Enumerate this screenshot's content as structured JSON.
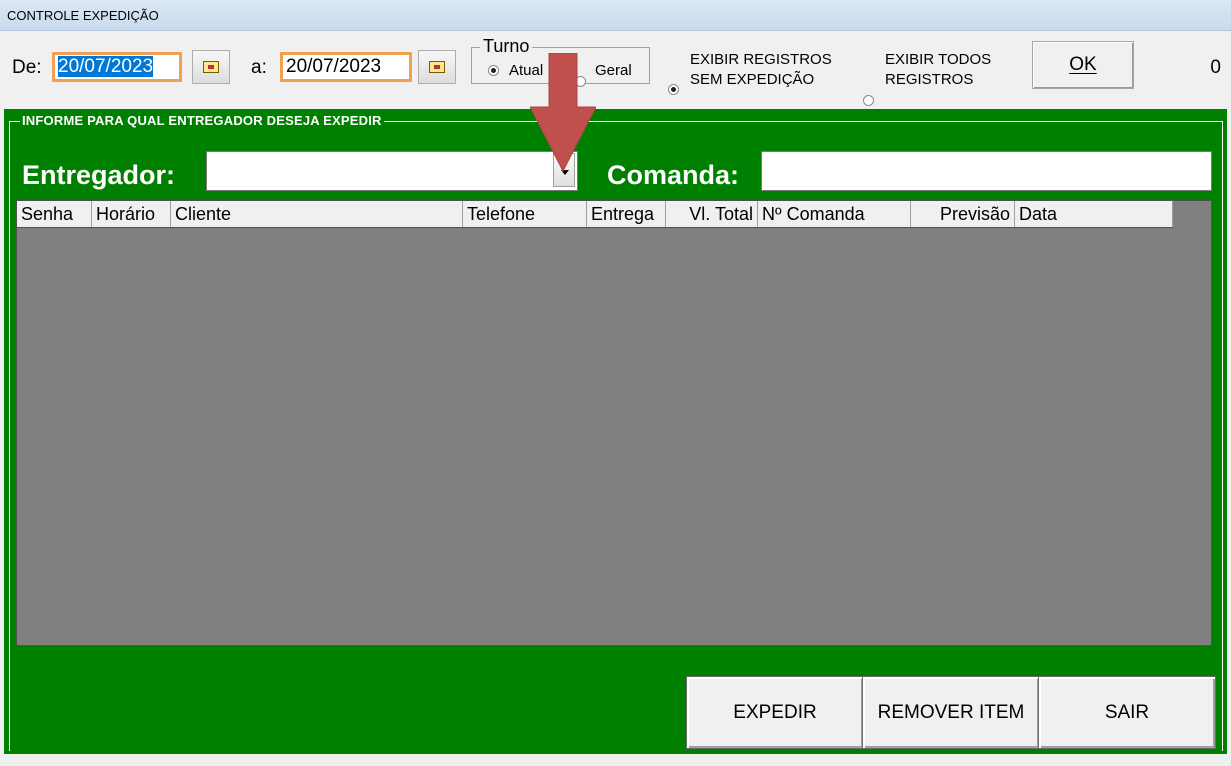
{
  "window": {
    "title": "CONTROLE EXPEDIÇÃO"
  },
  "filters": {
    "from_label": "De:",
    "from_date": "20/07/2023",
    "to_label": "a:",
    "to_date": "20/07/2023",
    "turno": {
      "legend": "Turno",
      "options": [
        {
          "label": "Atual",
          "selected": true
        },
        {
          "label": "Geral",
          "selected": false
        }
      ]
    },
    "display_options": [
      {
        "label_line1": "EXIBIR REGISTROS",
        "label_line2": "SEM EXPEDIÇÃO",
        "selected": true
      },
      {
        "label_line1": "EXIBIR TODOS",
        "label_line2": "REGISTROS",
        "selected": false
      }
    ],
    "ok_label": "OK",
    "record_count": "0"
  },
  "panel": {
    "legend": "INFORME PARA QUAL ENTREGADOR DESEJA EXPEDIR",
    "entregador_label": "Entregador:",
    "entregador_value": "",
    "comanda_label": "Comanda:",
    "comanda_value": ""
  },
  "grid": {
    "columns": [
      "Senha",
      "Horário",
      "Cliente",
      "Telefone",
      "Entrega",
      "Vl. Total",
      "Nº Comanda",
      "Previsão",
      "Data"
    ],
    "rows": []
  },
  "actions": {
    "expedir": "EXPEDIR",
    "remover": "REMOVER ITEM",
    "sair": "SAIR"
  },
  "colors": {
    "panel_green": "#008000",
    "grid_gray": "#808080",
    "highlight_orange": "#f0a050",
    "annotation_arrow": "#c0504d"
  }
}
